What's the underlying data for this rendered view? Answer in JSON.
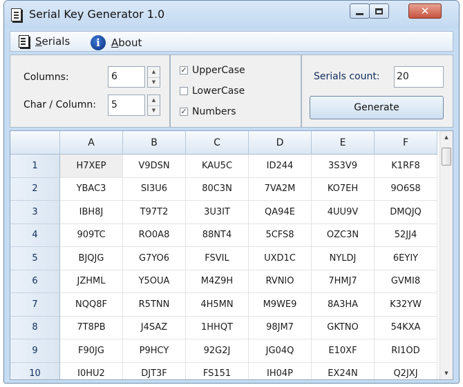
{
  "window": {
    "title": "Serial Key Generator 1.0",
    "controls": {
      "minimize": "—",
      "maximize": "□",
      "close": "✕"
    }
  },
  "menu": {
    "serials": {
      "accel": "S",
      "rest": "erials",
      "icon": "document-icon"
    },
    "about": {
      "accel": "A",
      "rest": "bout",
      "icon": "info-icon"
    }
  },
  "options": {
    "columns_label": "Columns:",
    "columns_value": "6",
    "char_per_column_label": "Char / Column:",
    "char_per_column_value": "5",
    "uppercase": {
      "label": "UpperCase",
      "checked": true
    },
    "lowercase": {
      "label": "LowerCase",
      "checked": false
    },
    "numbers": {
      "label": "Numbers",
      "checked": true
    },
    "serials_count_label": "Serials count:",
    "serials_count_value": "20",
    "generate_label": "Generate"
  },
  "grid": {
    "columns": [
      "A",
      "B",
      "C",
      "D",
      "E",
      "F"
    ],
    "rows": [
      {
        "n": "1",
        "cells": [
          "H7XEP",
          "V9DSN",
          "KAU5C",
          "ID244",
          "3S3V9",
          "K1RF8"
        ]
      },
      {
        "n": "2",
        "cells": [
          "YBAC3",
          "SI3U6",
          "80C3N",
          "7VA2M",
          "KO7EH",
          "9O6S8"
        ]
      },
      {
        "n": "3",
        "cells": [
          "IBH8J",
          "T97T2",
          "3U3IT",
          "QA94E",
          "4UU9V",
          "DMQJQ"
        ]
      },
      {
        "n": "4",
        "cells": [
          "909TC",
          "RO0A8",
          "88NT4",
          "5CFS8",
          "OZC3N",
          "52JJ4"
        ]
      },
      {
        "n": "5",
        "cells": [
          "BJQJG",
          "G7YO6",
          "FSVIL",
          "UXD1C",
          "NYLDJ",
          "6EYIY"
        ]
      },
      {
        "n": "6",
        "cells": [
          "JZHML",
          "Y5OUA",
          "M4Z9H",
          "RVNIO",
          "7HMJ7",
          "GVMI8"
        ]
      },
      {
        "n": "7",
        "cells": [
          "NQQ8F",
          "R5TNN",
          "4H5MN",
          "M9WE9",
          "8A3HA",
          "K32YW"
        ]
      },
      {
        "n": "8",
        "cells": [
          "7T8PB",
          "J4SAZ",
          "1HHQT",
          "98JM7",
          "GKTNO",
          "54KXA"
        ]
      },
      {
        "n": "9",
        "cells": [
          "F90JG",
          "P9HCY",
          "92G2J",
          "JG04Q",
          "E10XF",
          "RI1OD"
        ]
      },
      {
        "n": "10",
        "cells": [
          "I0HU2",
          "DJT3F",
          "FS151",
          "IH04P",
          "EX24N",
          "Q2JXJ"
        ]
      }
    ]
  }
}
